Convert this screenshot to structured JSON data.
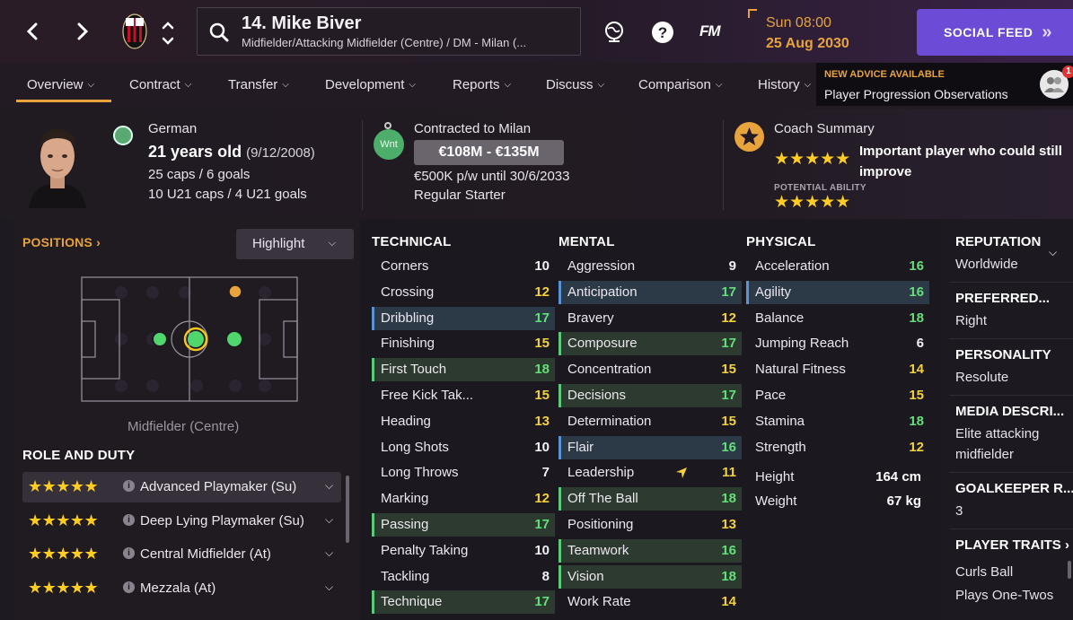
{
  "header": {
    "player_name": "14. Mike Biver",
    "player_subtitle": "Midfielder/Attacking Midfielder (Centre) / DM - Milan (...",
    "date_time": "Sun 08:00",
    "date_date": "25 Aug 2030",
    "fm_logo": "FM",
    "social_feed": "SOCIAL FEED"
  },
  "tabs": [
    {
      "label": "Overview"
    },
    {
      "label": "Contract"
    },
    {
      "label": "Transfer"
    },
    {
      "label": "Development"
    },
    {
      "label": "Reports"
    },
    {
      "label": "Discuss"
    },
    {
      "label": "Comparison"
    },
    {
      "label": "History"
    }
  ],
  "advice": {
    "title": "NEW ADVICE AVAILABLE",
    "text": "Player Progression Observations",
    "badge": "1"
  },
  "info": {
    "nationality": "German",
    "age": "21 years old",
    "dob": "(9/12/2008)",
    "caps": "25 caps / 6 goals",
    "u21_caps": "10 U21 caps / 4 U21 goals",
    "wnt": "Wnt",
    "contract_to": "Contracted to Milan",
    "value_range": "€108M - €135M",
    "wage": "€500K p/w until 30/6/2033",
    "squad_status": "Regular Starter",
    "coach_summary_title": "Coach Summary",
    "coach_summary_text": "Important player who could still improve",
    "current_ability_stars": "★★★★★",
    "potential_label": "POTENTIAL ABILITY",
    "potential_stars": "★★★★★"
  },
  "positions": {
    "title": "POSITIONS ›",
    "highlight_label": "Highlight",
    "position_label": "Midfielder (Centre)"
  },
  "roles": {
    "title": "ROLE AND DUTY",
    "items": [
      {
        "stars": "★★★★★",
        "name": "Advanced Playmaker (Su)"
      },
      {
        "stars": "★★★★★",
        "name": "Deep Lying Playmaker (Su)"
      },
      {
        "stars": "★★★★★",
        "name": "Central Midfielder (At)"
      },
      {
        "stars": "★★★★★",
        "name": "Mezzala (At)"
      }
    ]
  },
  "technical": {
    "title": "TECHNICAL",
    "attrs": [
      {
        "name": "Corners",
        "value": "10"
      },
      {
        "name": "Crossing",
        "value": "12"
      },
      {
        "name": "Dribbling",
        "value": "17"
      },
      {
        "name": "Finishing",
        "value": "15"
      },
      {
        "name": "First Touch",
        "value": "18"
      },
      {
        "name": "Free Kick Tak...",
        "value": "15"
      },
      {
        "name": "Heading",
        "value": "13"
      },
      {
        "name": "Long Shots",
        "value": "10"
      },
      {
        "name": "Long Throws",
        "value": "7"
      },
      {
        "name": "Marking",
        "value": "12"
      },
      {
        "name": "Passing",
        "value": "17"
      },
      {
        "name": "Penalty Taking",
        "value": "10"
      },
      {
        "name": "Tackling",
        "value": "8"
      },
      {
        "name": "Technique",
        "value": "17"
      }
    ]
  },
  "mental": {
    "title": "MENTAL",
    "attrs": [
      {
        "name": "Aggression",
        "value": "9"
      },
      {
        "name": "Anticipation",
        "value": "17"
      },
      {
        "name": "Bravery",
        "value": "12"
      },
      {
        "name": "Composure",
        "value": "17"
      },
      {
        "name": "Concentration",
        "value": "15"
      },
      {
        "name": "Decisions",
        "value": "17"
      },
      {
        "name": "Determination",
        "value": "15"
      },
      {
        "name": "Flair",
        "value": "16"
      },
      {
        "name": "Leadership",
        "value": "11"
      },
      {
        "name": "Off The Ball",
        "value": "18"
      },
      {
        "name": "Positioning",
        "value": "13"
      },
      {
        "name": "Teamwork",
        "value": "16"
      },
      {
        "name": "Vision",
        "value": "18"
      },
      {
        "name": "Work Rate",
        "value": "14"
      }
    ]
  },
  "physical": {
    "title": "PHYSICAL",
    "attrs": [
      {
        "name": "Acceleration",
        "value": "16"
      },
      {
        "name": "Agility",
        "value": "16"
      },
      {
        "name": "Balance",
        "value": "18"
      },
      {
        "name": "Jumping Reach",
        "value": "6"
      },
      {
        "name": "Natural Fitness",
        "value": "14"
      },
      {
        "name": "Pace",
        "value": "15"
      },
      {
        "name": "Stamina",
        "value": "18"
      },
      {
        "name": "Strength",
        "value": "12"
      }
    ],
    "height_label": "Height",
    "height_value": "164 cm",
    "weight_label": "Weight",
    "weight_value": "67 kg"
  },
  "sidepanel": {
    "reputation_title": "REPUTATION",
    "reputation_value": "Worldwide",
    "preferred_title": "PREFERRED...",
    "preferred_value": "Right",
    "personality_title": "PERSONALITY",
    "personality_value": "Resolute",
    "media_title": "MEDIA DESCRI...",
    "media_value_1": "Elite attacking",
    "media_value_2": "midfielder",
    "gk_title": "GOALKEEPER R...",
    "gk_value": "3",
    "traits_title": "PLAYER TRAITS ›",
    "trait_1": "Curls Ball",
    "trait_2": "Plays One-Twos"
  },
  "colors": {
    "accent_orange": "#e8a33d",
    "social_purple": "#6c4bd6",
    "value_green": "#63e07a",
    "value_yellow": "#f3d23a"
  }
}
